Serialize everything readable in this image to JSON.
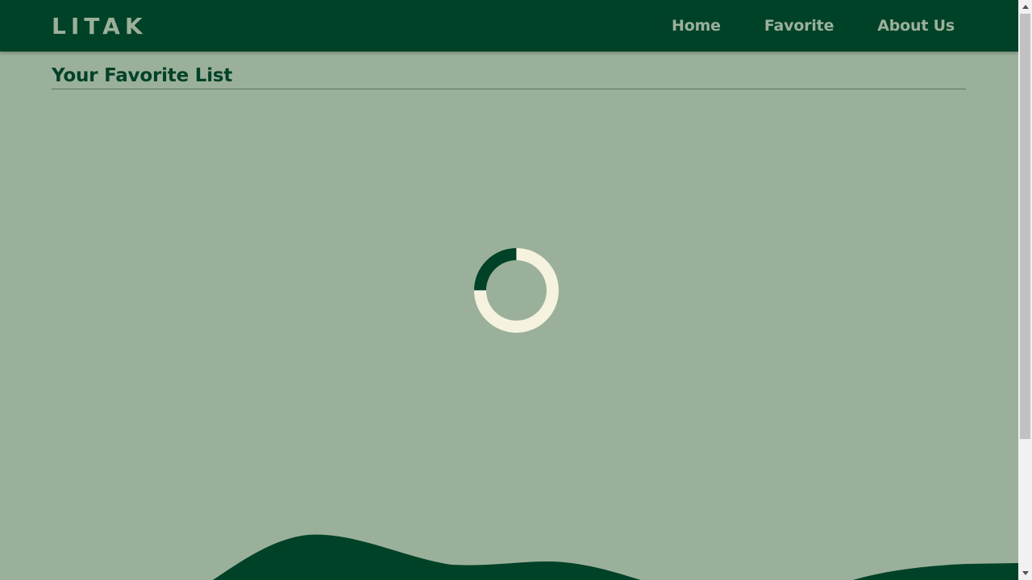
{
  "navbar": {
    "brand": "LITAK",
    "links": [
      {
        "label": "Home"
      },
      {
        "label": "Favorite"
      },
      {
        "label": "About Us"
      }
    ]
  },
  "main": {
    "title": "Your Favorite List",
    "loading": true
  },
  "colors": {
    "primary": "#004228",
    "background": "#9bb09a",
    "spinner_track": "#f5f3e0",
    "nav_text": "#9bb09a"
  },
  "icons": {
    "spinner": "loading-spinner-icon"
  }
}
